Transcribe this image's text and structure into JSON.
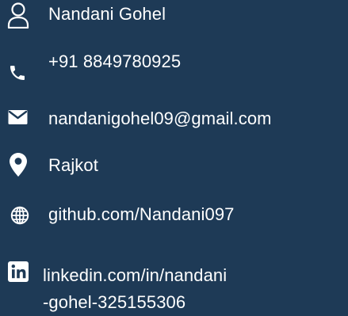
{
  "background_color": "#1e3a56",
  "text_color": "#ffffff",
  "contact": {
    "name": {
      "icon": "person-icon",
      "text": "Nandani Gohel"
    },
    "phone": {
      "icon": "phone-icon",
      "text": "+91 8849780925"
    },
    "email": {
      "icon": "envelope-icon",
      "text": "nandanigohel09@gmail.com"
    },
    "location": {
      "icon": "location-pin-icon",
      "text": "Rajkot"
    },
    "github": {
      "icon": "globe-icon",
      "text": "github.com/Nandani097"
    },
    "linkedin": {
      "icon": "linkedin-icon",
      "line1": "linkedin.com/in/nandani",
      "line2": "-gohel-325155306"
    }
  }
}
